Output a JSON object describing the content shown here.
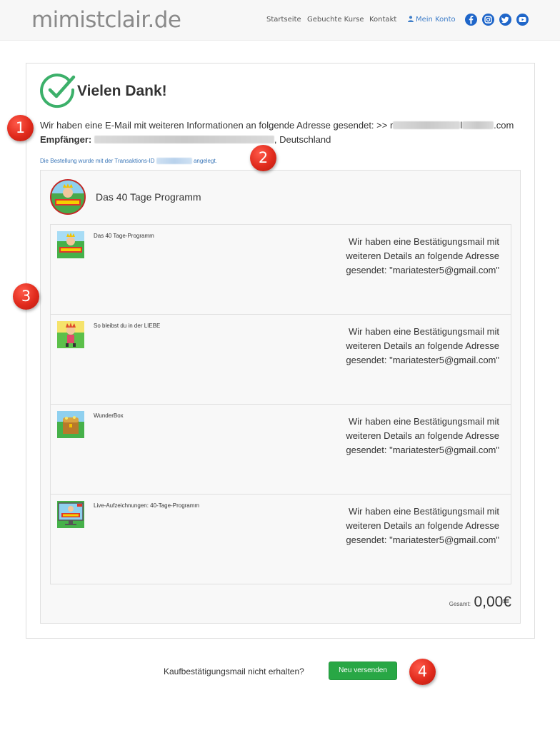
{
  "header": {
    "logo": "mimistclair.de",
    "nav": [
      {
        "label": "Startseite"
      },
      {
        "label": "Gebuchte Kurse"
      },
      {
        "label": "Kontakt"
      },
      {
        "label": "Mein Konto",
        "icon": "person-icon"
      }
    ],
    "social": [
      {
        "icon": "facebook-icon",
        "color": "#1f66c9"
      },
      {
        "icon": "instagram-icon",
        "color": "#1f66c9"
      },
      {
        "icon": "twitter-icon",
        "color": "#1f66c9"
      },
      {
        "icon": "youtube-icon",
        "color": "#1f66c9"
      }
    ]
  },
  "confirmation": {
    "title": "Vielen Dank!",
    "email_info_prefix": "Wir haben eine E-Mail mit weiteren Informationen an folgende Adresse gesendet: >> r",
    "email_info_mid": "l",
    "email_info_suffix": ".com",
    "recipient_label": "Empfänger:",
    "recipient_country": ", Deutschland",
    "transaction_prefix": "Die Bestellung wurde mit der Transaktions-ID",
    "transaction_suffix": "angelegt."
  },
  "order": {
    "program_title": "Das 40 Tage Programm",
    "items": [
      {
        "name": "Das 40 Tage-Programm",
        "message": "Wir haben eine Bestätigungsmail mit weiteren Details an folgende Adresse gesendet: \"mariatester5@gmail.com\""
      },
      {
        "name": "So bleibst du in der LIEBE",
        "message": "Wir haben eine Bestätigungsmail mit weiteren Details an folgende Adresse gesendet: \"mariatester5@gmail.com\""
      },
      {
        "name": "WunderBox",
        "message": "Wir haben eine Bestätigungsmail mit weiteren Details an folgende Adresse gesendet: \"mariatester5@gmail.com\""
      },
      {
        "name": "Live-Aufzeichnungen: 40-Tage-Programm",
        "message": "Wir haben eine Bestätigungsmail mit weiteren Details an folgende Adresse gesendet: \"mariatester5@gmail.com\""
      }
    ],
    "total_label": "Gesamt:",
    "total_value": "0,00€"
  },
  "resend": {
    "text": "Kaufbestätigungsmail nicht erhalten?",
    "button_label": "Neu versenden"
  },
  "markers": [
    "1",
    "2",
    "3",
    "4"
  ],
  "colors": {
    "accent_green": "#28a745",
    "check_green": "#3cb06a",
    "link_blue": "#3a76b8",
    "marker_red": "#e02a1c"
  }
}
